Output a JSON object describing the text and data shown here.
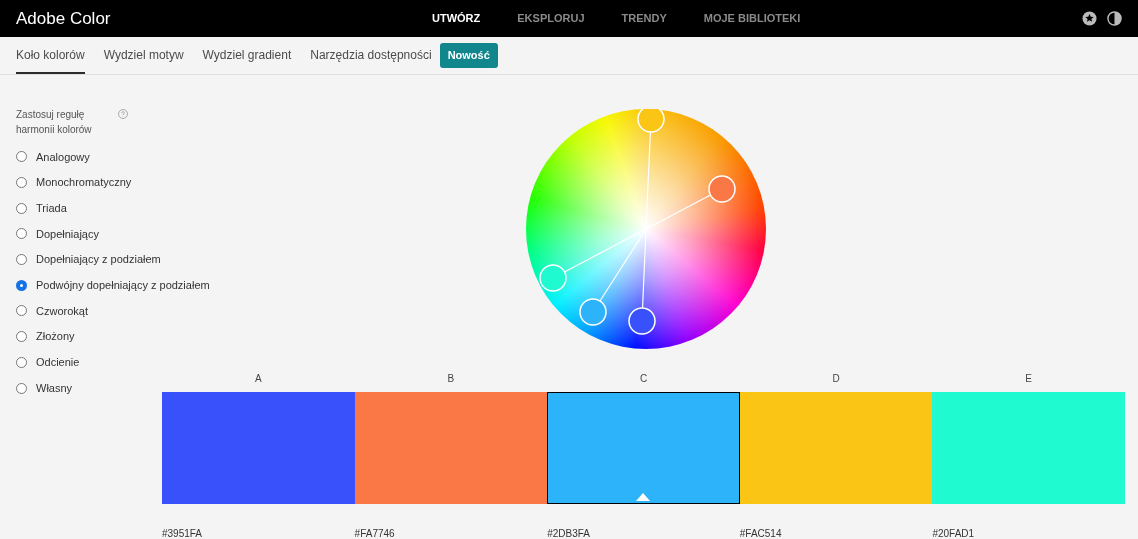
{
  "app_title": "Adobe Color",
  "nav": [
    {
      "label": "UTWÓRZ",
      "selected": true
    },
    {
      "label": "EKSPLORUJ",
      "selected": false
    },
    {
      "label": "TRENDY",
      "selected": false
    },
    {
      "label": "MOJE BIBLIOTEKI",
      "selected": false
    }
  ],
  "tabs": [
    {
      "label": "Koło kolorów",
      "selected": true
    },
    {
      "label": "Wydziel motyw",
      "selected": false
    },
    {
      "label": "Wydziel gradient",
      "selected": false
    },
    {
      "label": "Narzędzia dostępności",
      "selected": false
    }
  ],
  "new_badge": "Nowość",
  "harmony": {
    "title": "Zastosuj regułę harmonii kolorów",
    "options": [
      {
        "label": "Analogowy",
        "selected": false
      },
      {
        "label": "Monochromatyczny",
        "selected": false
      },
      {
        "label": "Triada",
        "selected": false
      },
      {
        "label": "Dopełniający",
        "selected": false
      },
      {
        "label": "Dopełniający z podziałem",
        "selected": false
      },
      {
        "label": "Podwójny dopełniający z podziałem",
        "selected": true
      },
      {
        "label": "Czworokąt",
        "selected": false
      },
      {
        "label": "Złożony",
        "selected": false
      },
      {
        "label": "Odcienie",
        "selected": false
      },
      {
        "label": "Własny",
        "selected": false
      }
    ]
  },
  "swatches": [
    {
      "label": "A",
      "hex": "#3951FA",
      "color": "#3951fa",
      "selected": false
    },
    {
      "label": "B",
      "hex": "#FA7746",
      "color": "#fa7746",
      "selected": false
    },
    {
      "label": "C",
      "hex": "#2DB3FA",
      "color": "#2db3fa",
      "selected": true
    },
    {
      "label": "D",
      "hex": "#FAC514",
      "color": "#fac514",
      "selected": false
    },
    {
      "label": "E",
      "hex": "#20FAD1",
      "color": "#20fad1",
      "selected": false
    }
  ]
}
